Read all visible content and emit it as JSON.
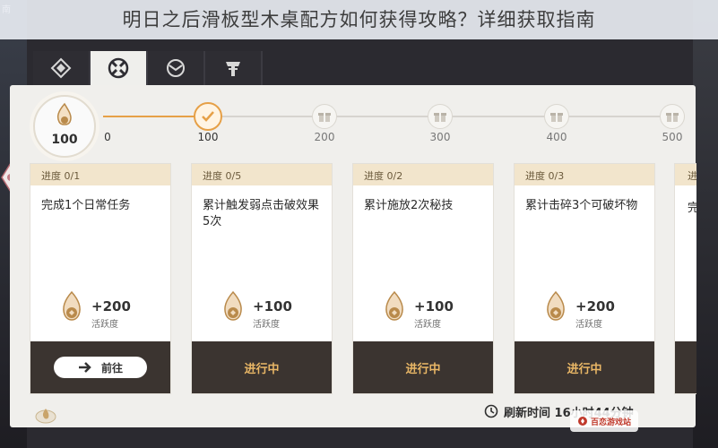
{
  "headline": "明日之后滑板型木桌配方如何获得攻略？详细获取指南",
  "edge_text": "南",
  "tabs": [
    {
      "icon": "diamond-pattern-icon",
      "active": false
    },
    {
      "icon": "compass-cross-icon",
      "active": true
    },
    {
      "icon": "target-wing-icon",
      "active": false
    },
    {
      "icon": "shield-pillar-icon",
      "active": false
    }
  ],
  "score": {
    "icon": "flame-token-icon",
    "value": "100"
  },
  "milestones": [
    {
      "label": "0",
      "reached": true
    },
    {
      "label": "100",
      "reached": true,
      "icon": "check-icon"
    },
    {
      "label": "200",
      "reached": false,
      "icon": "gift-icon"
    },
    {
      "label": "300",
      "reached": false,
      "icon": "gift-icon"
    },
    {
      "label": "400",
      "reached": false,
      "icon": "gift-icon"
    },
    {
      "label": "500",
      "reached": false,
      "icon": "gift-icon"
    }
  ],
  "progress_fraction": 0.2,
  "tasks": [
    {
      "progress": "进度 0/1",
      "title": "完成1个日常任务",
      "reward": "+200",
      "reward_label": "活跃度",
      "button": "前往",
      "button_type": "go"
    },
    {
      "progress": "进度 0/5",
      "title": "累计触发弱点击破效果5次",
      "reward": "+100",
      "reward_label": "活跃度",
      "button": "进行中",
      "button_type": "status"
    },
    {
      "progress": "进度 0/2",
      "title": "累计施放2次秘技",
      "reward": "+100",
      "reward_label": "活跃度",
      "button": "进行中",
      "button_type": "status"
    },
    {
      "progress": "进度 0/3",
      "title": "累计击碎3个可破坏物",
      "reward": "+200",
      "reward_label": "活跃度",
      "button": "进行中",
      "button_type": "status"
    }
  ],
  "partial_card": {
    "progress": "进",
    "title": "完"
  },
  "refresh": {
    "icon": "clock-icon",
    "text": "刷新时间 16小时44分钟"
  },
  "watermark": {
    "text": "百恋游戏站"
  },
  "colors": {
    "accent": "#e6a047",
    "card_header": "#f2e5cc",
    "button_bg": "#3b3430",
    "status_text": "#e9b766",
    "panel": "#f0efec"
  }
}
